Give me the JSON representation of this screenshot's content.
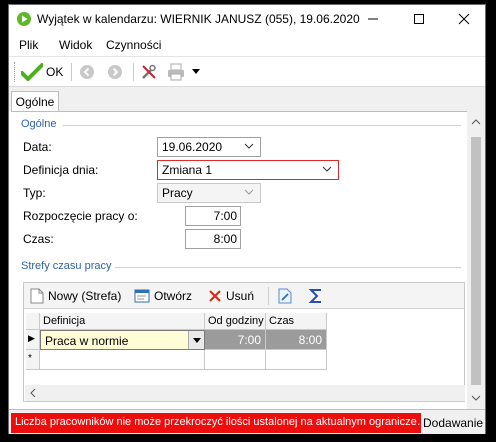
{
  "window": {
    "title": "Wyjątek w kalendarzu: WIERNIK JANUSZ (055), 19.06.2020",
    "minimize_icon": "minimize-icon",
    "maximize_icon": "maximize-icon",
    "close_icon": "close-icon"
  },
  "menu": [
    "Plik",
    "Widok",
    "Czynności"
  ],
  "toolbar": {
    "ok_label": "OK",
    "icons": [
      "checkmark-icon",
      "back-icon",
      "forward-icon",
      "tools-icon",
      "print-icon",
      "dropdown-arrow-icon"
    ]
  },
  "tabs": [
    "Ogólne"
  ],
  "general": {
    "section_title": "Ogólne",
    "date_label": "Data:",
    "date_value": "19.06.2020",
    "daydef_label": "Definicja dnia:",
    "daydef_value": "Zmiana 1",
    "type_label": "Typ:",
    "type_value": "Pracy",
    "start_label": "Rozpoczęcie pracy o:",
    "start_value": "7:00",
    "time_label": "Czas:",
    "time_value": "8:00"
  },
  "zones": {
    "section_title": "Strefy czasu pracy",
    "new_label": "Nowy (Strefa)",
    "open_label": "Otwórz",
    "delete_label": "Usuń",
    "columns": [
      "Definicja",
      "Od godziny",
      "Czas"
    ],
    "rows": [
      {
        "definition": "Praca w normie",
        "from": "7:00",
        "duration": "8:00"
      }
    ],
    "new_row_marker": "*",
    "current_row_marker": "▶"
  },
  "status": {
    "error_text": "Liczba pracowników nie może przekroczyć ilości ustalonej na aktualnym ogranicze…",
    "mode": "Dodawanie"
  },
  "colors": {
    "accent_blue": "#3061a8",
    "error_red": "#ee0d0d",
    "ok_green": "#4caf1f"
  }
}
